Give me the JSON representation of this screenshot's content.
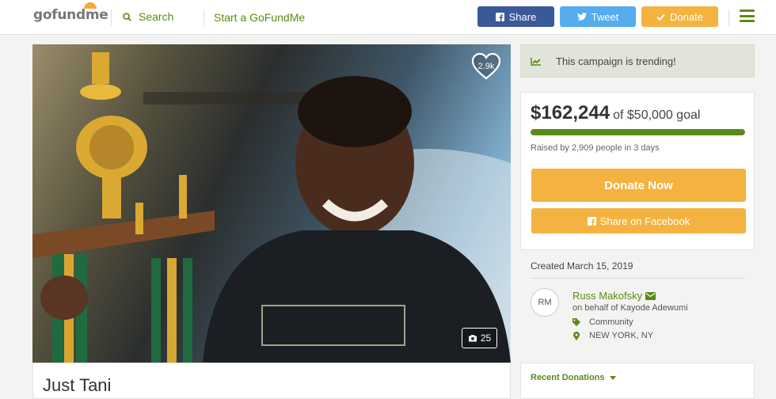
{
  "header": {
    "logo": "gofundme",
    "search_label": "Search",
    "start_label": "Start a GoFundMe",
    "share_label": "Share",
    "tweet_label": "Tweet",
    "donate_label": "Donate"
  },
  "hero": {
    "likes": "2.9k",
    "photo_count": "25"
  },
  "campaign": {
    "title": "Just Tani",
    "trending": "This campaign is trending!",
    "raised_amount": "$162,244",
    "goal_text": "of $50,000 goal",
    "progress_fraction": 1.0,
    "raised_by": "Raised by 2,909 people in 3 days",
    "donate_now_label": "Donate Now",
    "share_facebook_label": "Share on Facebook",
    "created": "Created March 15, 2019"
  },
  "organizer": {
    "initials": "RM",
    "name": "Russ Makofsky",
    "on_behalf": "on behalf of Kayode Adewumi",
    "category": "Community",
    "location": "NEW YORK, NY"
  },
  "recent_donations_label": "Recent Donations",
  "colors": {
    "brand_green": "#5d8a14",
    "donate_orange": "#f4b340",
    "facebook_blue": "#3b5998",
    "twitter_blue": "#55acee"
  }
}
